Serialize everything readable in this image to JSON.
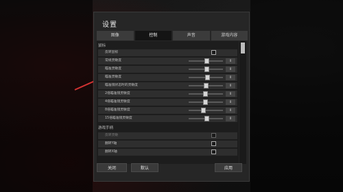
{
  "dialog": {
    "title": "设置"
  },
  "tabs": [
    {
      "label": "图像",
      "active": false
    },
    {
      "label": "控制",
      "active": true
    },
    {
      "label": "声音",
      "active": false
    },
    {
      "label": "游戏内容",
      "active": false
    }
  ],
  "sections": {
    "mouse": "鼠标",
    "gamepad": "游戏手柄"
  },
  "mouse_rows": [
    {
      "label": "反转鼠标",
      "type": "checkbox",
      "checked": false
    },
    {
      "label": "常规灵敏度",
      "type": "slider",
      "level": 0.54
    },
    {
      "label": "瞄准灵敏度",
      "type": "slider",
      "level": 0.54
    },
    {
      "label": "瞄准灵敏度",
      "type": "slider",
      "level": 0.56
    },
    {
      "label": "瞄准镜状态时的灵敏度",
      "type": "slider",
      "level": 0.5
    },
    {
      "label": "2倍瞄准镜灵敏度",
      "type": "slider",
      "level": 0.48
    },
    {
      "label": "4倍瞄准镜灵敏度",
      "type": "slider",
      "level": 0.48
    },
    {
      "label": "8倍瞄准镜灵敏度",
      "type": "slider",
      "level": 0.43
    },
    {
      "label": "15倍瞄准镜灵敏度",
      "type": "slider",
      "level": 0.54
    }
  ],
  "gamepad_rows": [
    {
      "label": "反转灵敏",
      "type": "checkbox",
      "checked": false,
      "disabled": true
    },
    {
      "label": "翻转Y轴",
      "type": "checkbox",
      "checked": false
    },
    {
      "label": "翻转X轴",
      "type": "checkbox",
      "checked": false
    }
  ],
  "slider_value_label": "0",
  "footer": {
    "close_label": "关闭",
    "default_label": "默认",
    "apply_label": "应用"
  },
  "colors": {
    "annotation_arrow": "#d23232"
  }
}
